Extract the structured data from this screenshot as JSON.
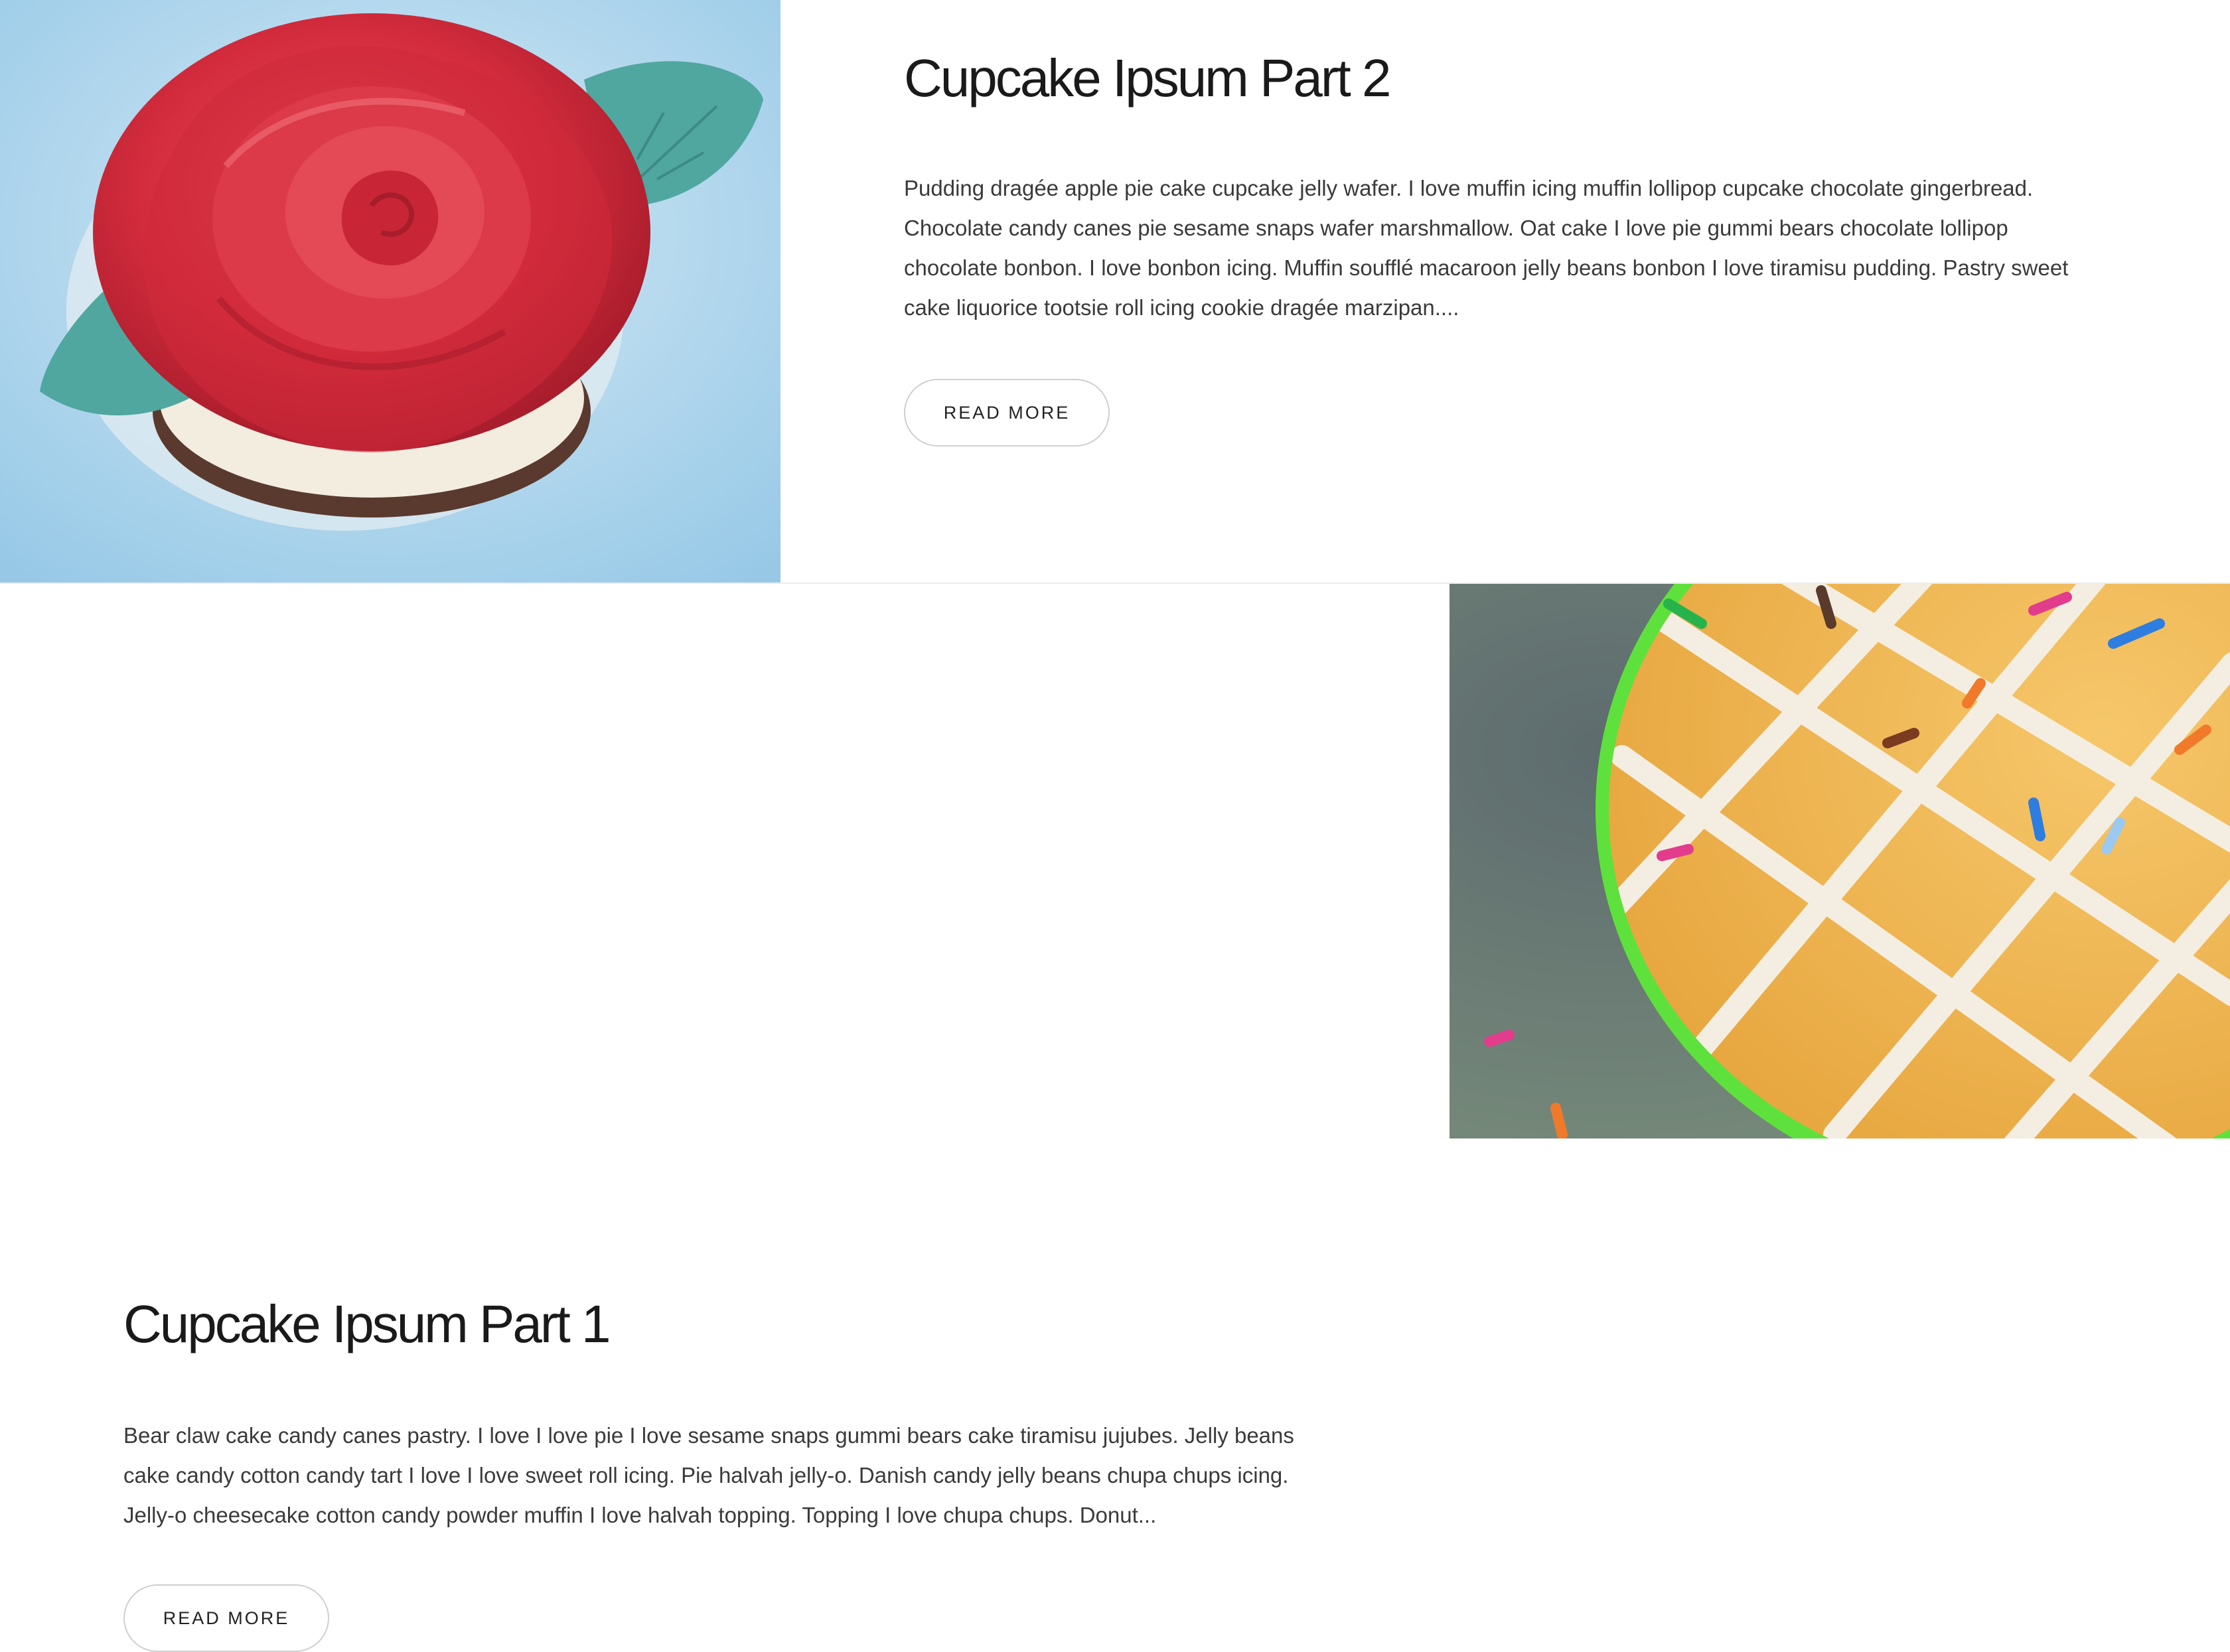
{
  "posts": [
    {
      "title": "Cupcake Ipsum Part 2",
      "excerpt": "Pudding dragée apple pie cake cupcake jelly wafer. I love muffin icing muffin lollipop cupcake chocolate gingerbread. Chocolate candy canes pie sesame snaps wafer marshmallow. Oat cake I love pie gummi bears chocolate lollipop chocolate bonbon. I love bonbon icing. Muffin soufflé macaroon jelly beans bonbon I love tiramisu pudding. Pastry sweet cake liquorice tootsie roll icing cookie dragée marzipan....",
      "button_label": "READ MORE",
      "image": "red-rose-cupcake-photo"
    },
    {
      "title": "Cupcake Ipsum Part 1",
      "excerpt": "Bear claw cake candy canes pastry. I love I love pie I love sesame snaps gummi bears cake tiramisu jujubes. Jelly beans cake candy cotton candy tart I love I love sweet roll icing. Pie halvah jelly-o. Danish candy jelly beans chupa chups icing. Jelly-o cheesecake cotton candy powder muffin I love halvah topping. Topping I love chupa chups. Donut...",
      "button_label": "READ MORE",
      "image": "lattice-iced-cupcake-photo"
    }
  ],
  "colors": {
    "background": "#ffffff",
    "title": "#1a1a1a",
    "text": "#3a3a3a",
    "button_border": "#cfcfcf",
    "divider": "#ececec"
  }
}
